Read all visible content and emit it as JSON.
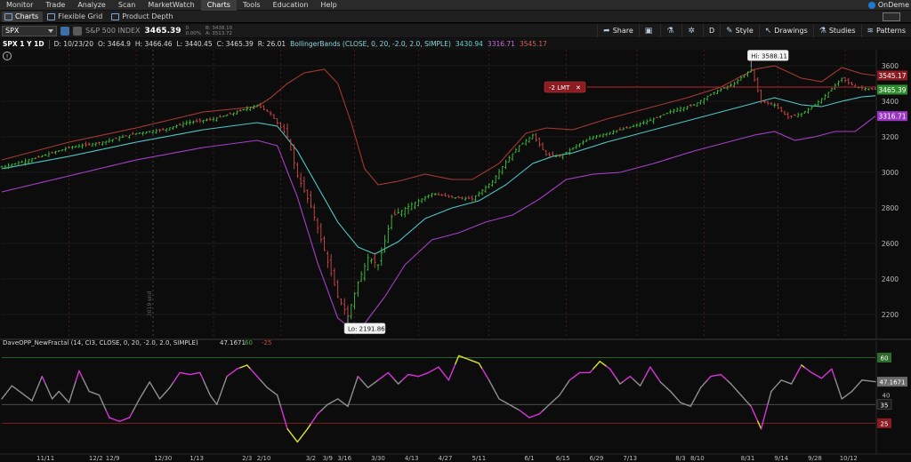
{
  "menu": {
    "items": [
      "Monitor",
      "Trade",
      "Analyze",
      "Scan",
      "MarketWatch",
      "Charts",
      "Tools",
      "Education",
      "Help"
    ],
    "active": "Charts",
    "right_label": "OnDeme"
  },
  "subtabs": {
    "items": [
      "Charts",
      "Flexible Grid",
      "Product Depth"
    ],
    "active": "Charts"
  },
  "symbol": {
    "ticker": "SPX",
    "name": "S&P 500 INDEX",
    "last": "3465.39",
    "change": "0",
    "change_pct": "0.00%",
    "bid": "B: 3438.10",
    "ask": "A: 3513.72"
  },
  "toolbar": {
    "share": "Share",
    "period": "D",
    "style": "Style",
    "drawings": "Drawings",
    "studies": "Studies",
    "patterns": "Patterns"
  },
  "info": {
    "aggregation": "SPX 1 Y 1D",
    "date": "D: 10/23/20",
    "open": "O: 3464.9",
    "high": "H: 3466.46",
    "low": "L: 3440.45",
    "close": "C: 3465.39",
    "range": "R: 26.01",
    "study": "BollingerBands (CLOSE, 0, 20, -2.0, 2.0, SIMPLE)",
    "bb_mid": "3430.94",
    "bb_low": "3316.71",
    "bb_up": "3545.17"
  },
  "colors": {
    "up_bar": "#3fbf3f",
    "down_bar": "#d24848",
    "bb_upper": "#a33a32",
    "bb_middle": "#4fc4c4",
    "bb_lower": "#a63ec9",
    "osc_main": "#8f8f8f",
    "osc_high": "#d633d6",
    "osc_low": "#d9e324",
    "order_line": "#b3262b",
    "background": "#0c0c0c"
  },
  "chart_data": {
    "type": "line",
    "price_axis": {
      "min": 2100,
      "max": 3650,
      "ticks": [
        2200,
        2400,
        2600,
        2800,
        3000,
        3200,
        3400,
        3600,
        3800
      ]
    },
    "price_labels": [
      {
        "value": 3545.17,
        "text": "3545.17",
        "kind": "bb_up"
      },
      {
        "value": 3465.39,
        "text": "3465.39",
        "kind": "last"
      },
      {
        "value": 3316.71,
        "text": "3316.71",
        "kind": "bb_low"
      }
    ],
    "x_labels": [
      "11/11",
      "12/2",
      "12/9",
      "12/30",
      "1/13",
      "2/3",
      "2/10",
      "3/2",
      "3/9",
      "3/16",
      "3/30",
      "4/13",
      "4/27",
      "5/11",
      "6/1",
      "6/15",
      "6/29",
      "7/13",
      "8/3",
      "8/10",
      "8/31",
      "9/14",
      "9/28",
      "10/12"
    ],
    "x_label_idx": [
      13,
      28,
      33,
      48,
      58,
      73,
      78,
      92,
      97,
      102,
      112,
      122,
      132,
      142,
      157,
      167,
      177,
      187,
      202,
      207,
      222,
      232,
      242,
      252
    ],
    "vertical_markers": [
      {
        "text": "2019 end",
        "idx": 45
      }
    ],
    "close_anchors": [
      [
        0,
        3030
      ],
      [
        10,
        3080
      ],
      [
        20,
        3140
      ],
      [
        30,
        3170
      ],
      [
        40,
        3220
      ],
      [
        48,
        3240
      ],
      [
        55,
        3280
      ],
      [
        63,
        3300
      ],
      [
        70,
        3340
      ],
      [
        76,
        3380
      ],
      [
        80,
        3330
      ],
      [
        85,
        3200
      ],
      [
        88,
        2980
      ],
      [
        92,
        2810
      ],
      [
        96,
        2560
      ],
      [
        100,
        2300
      ],
      [
        103,
        2192
      ],
      [
        106,
        2380
      ],
      [
        109,
        2520
      ],
      [
        112,
        2480
      ],
      [
        116,
        2750
      ],
      [
        122,
        2820
      ],
      [
        128,
        2880
      ],
      [
        134,
        2860
      ],
      [
        140,
        2850
      ],
      [
        146,
        2950
      ],
      [
        150,
        3060
      ],
      [
        154,
        3150
      ],
      [
        158,
        3210
      ],
      [
        162,
        3100
      ],
      [
        166,
        3090
      ],
      [
        171,
        3150
      ],
      [
        176,
        3200
      ],
      [
        182,
        3230
      ],
      [
        188,
        3260
      ],
      [
        194,
        3300
      ],
      [
        200,
        3350
      ],
      [
        206,
        3380
      ],
      [
        212,
        3450
      ],
      [
        218,
        3500
      ],
      [
        223,
        3580
      ],
      [
        226,
        3400
      ],
      [
        230,
        3380
      ],
      [
        234,
        3310
      ],
      [
        238,
        3330
      ],
      [
        242,
        3380
      ],
      [
        246,
        3450
      ],
      [
        250,
        3530
      ],
      [
        254,
        3480
      ],
      [
        258,
        3470
      ],
      [
        260,
        3465.39
      ]
    ],
    "bb_upper_anchors": [
      [
        0,
        3070
      ],
      [
        20,
        3170
      ],
      [
        40,
        3250
      ],
      [
        60,
        3340
      ],
      [
        76,
        3370
      ],
      [
        80,
        3420
      ],
      [
        85,
        3500
      ],
      [
        90,
        3560
      ],
      [
        96,
        3580
      ],
      [
        100,
        3500
      ],
      [
        104,
        3280
      ],
      [
        108,
        3020
      ],
      [
        112,
        2930
      ],
      [
        118,
        2950
      ],
      [
        126,
        2990
      ],
      [
        134,
        2960
      ],
      [
        140,
        2960
      ],
      [
        148,
        3050
      ],
      [
        156,
        3220
      ],
      [
        162,
        3250
      ],
      [
        170,
        3240
      ],
      [
        180,
        3300
      ],
      [
        192,
        3360
      ],
      [
        204,
        3420
      ],
      [
        214,
        3480
      ],
      [
        224,
        3580
      ],
      [
        230,
        3600
      ],
      [
        238,
        3530
      ],
      [
        244,
        3510
      ],
      [
        250,
        3590
      ],
      [
        256,
        3555
      ],
      [
        260,
        3545.17
      ]
    ],
    "bb_middle_anchors": [
      [
        0,
        3020
      ],
      [
        20,
        3090
      ],
      [
        40,
        3170
      ],
      [
        60,
        3240
      ],
      [
        76,
        3280
      ],
      [
        82,
        3260
      ],
      [
        88,
        3120
      ],
      [
        94,
        2920
      ],
      [
        100,
        2720
      ],
      [
        106,
        2580
      ],
      [
        111,
        2540
      ],
      [
        118,
        2610
      ],
      [
        126,
        2740
      ],
      [
        134,
        2800
      ],
      [
        142,
        2840
      ],
      [
        150,
        2930
      ],
      [
        158,
        3050
      ],
      [
        164,
        3090
      ],
      [
        170,
        3110
      ],
      [
        180,
        3170
      ],
      [
        192,
        3230
      ],
      [
        204,
        3290
      ],
      [
        214,
        3340
      ],
      [
        224,
        3390
      ],
      [
        230,
        3420
      ],
      [
        238,
        3380
      ],
      [
        244,
        3370
      ],
      [
        250,
        3400
      ],
      [
        256,
        3425
      ],
      [
        260,
        3430.94
      ]
    ],
    "bb_lower_anchors": [
      [
        0,
        2890
      ],
      [
        20,
        2980
      ],
      [
        40,
        3070
      ],
      [
        60,
        3140
      ],
      [
        76,
        3180
      ],
      [
        82,
        3150
      ],
      [
        88,
        2860
      ],
      [
        94,
        2490
      ],
      [
        100,
        2180
      ],
      [
        104,
        2120
      ],
      [
        108,
        2150
      ],
      [
        114,
        2300
      ],
      [
        120,
        2480
      ],
      [
        128,
        2620
      ],
      [
        136,
        2660
      ],
      [
        144,
        2720
      ],
      [
        152,
        2760
      ],
      [
        160,
        2850
      ],
      [
        168,
        2960
      ],
      [
        176,
        2990
      ],
      [
        184,
        3000
      ],
      [
        194,
        3050
      ],
      [
        206,
        3120
      ],
      [
        216,
        3170
      ],
      [
        224,
        3210
      ],
      [
        230,
        3230
      ],
      [
        236,
        3180
      ],
      [
        242,
        3200
      ],
      [
        248,
        3230
      ],
      [
        254,
        3230
      ],
      [
        260,
        3316.71
      ]
    ],
    "annotations": [
      {
        "text": "Hi: 3588.11",
        "idx": 223,
        "value": 3588.11
      },
      {
        "text": "Lo: 2191.86",
        "idx": 103,
        "value": 2191.86
      }
    ],
    "order": {
      "text": "-2 LMT",
      "value": 3480
    },
    "oscillator": {
      "label": "DaveOPP_NewFractal (14, CI3, CLOSE, 0, 20, -2.0, 2.0, SIMPLE)",
      "value": "47.1671",
      "level_high": "60",
      "level_low": "-25",
      "axis": {
        "min": 10,
        "max": 65,
        "ticks": [
          40,
          35,
          25
        ]
      },
      "right_labels": [
        {
          "value": 60,
          "text": "60"
        },
        {
          "value": 47.1671,
          "text": "47.1671"
        },
        {
          "value": 35,
          "text": "35"
        },
        {
          "value": 25,
          "text": "25"
        }
      ],
      "hlines": [
        60,
        35,
        25
      ],
      "anchors": [
        [
          0,
          38
        ],
        [
          3,
          45
        ],
        [
          6,
          41
        ],
        [
          9,
          37
        ],
        [
          12,
          50
        ],
        [
          15,
          38
        ],
        [
          17,
          42
        ],
        [
          20,
          36
        ],
        [
          23,
          53
        ],
        [
          26,
          42
        ],
        [
          29,
          40
        ],
        [
          32,
          28
        ],
        [
          35,
          26
        ],
        [
          38,
          28
        ],
        [
          41,
          38
        ],
        [
          44,
          47
        ],
        [
          47,
          38
        ],
        [
          50,
          44
        ],
        [
          53,
          52
        ],
        [
          56,
          51
        ],
        [
          59,
          52
        ],
        [
          62,
          40
        ],
        [
          64,
          35
        ],
        [
          67,
          50
        ],
        [
          70,
          54
        ],
        [
          73,
          56
        ],
        [
          76,
          50
        ],
        [
          79,
          44
        ],
        [
          82,
          40
        ],
        [
          85,
          22
        ],
        [
          88,
          15
        ],
        [
          91,
          22
        ],
        [
          94,
          30
        ],
        [
          97,
          35
        ],
        [
          100,
          38
        ],
        [
          103,
          34
        ],
        [
          106,
          50
        ],
        [
          109,
          44
        ],
        [
          112,
          48
        ],
        [
          115,
          52
        ],
        [
          118,
          46
        ],
        [
          121,
          51
        ],
        [
          124,
          50
        ],
        [
          127,
          52
        ],
        [
          130,
          55
        ],
        [
          133,
          48
        ],
        [
          136,
          61
        ],
        [
          139,
          59
        ],
        [
          142,
          57
        ],
        [
          145,
          48
        ],
        [
          148,
          38
        ],
        [
          151,
          35
        ],
        [
          154,
          32
        ],
        [
          157,
          28
        ],
        [
          160,
          30
        ],
        [
          163,
          35
        ],
        [
          166,
          40
        ],
        [
          169,
          48
        ],
        [
          172,
          52
        ],
        [
          175,
          52
        ],
        [
          178,
          58
        ],
        [
          181,
          54
        ],
        [
          184,
          46
        ],
        [
          187,
          50
        ],
        [
          190,
          45
        ],
        [
          193,
          55
        ],
        [
          196,
          47
        ],
        [
          199,
          42
        ],
        [
          202,
          36
        ],
        [
          205,
          34
        ],
        [
          208,
          44
        ],
        [
          211,
          50
        ],
        [
          214,
          51
        ],
        [
          217,
          46
        ],
        [
          220,
          40
        ],
        [
          223,
          34
        ],
        [
          226,
          22
        ],
        [
          229,
          42
        ],
        [
          232,
          48
        ],
        [
          235,
          46
        ],
        [
          238,
          56
        ],
        [
          241,
          52
        ],
        [
          244,
          49
        ],
        [
          247,
          54
        ],
        [
          250,
          38
        ],
        [
          253,
          42
        ],
        [
          256,
          48
        ],
        [
          260,
          47.17
        ]
      ],
      "high_threshold": 48,
      "low_threshold": 32
    }
  }
}
